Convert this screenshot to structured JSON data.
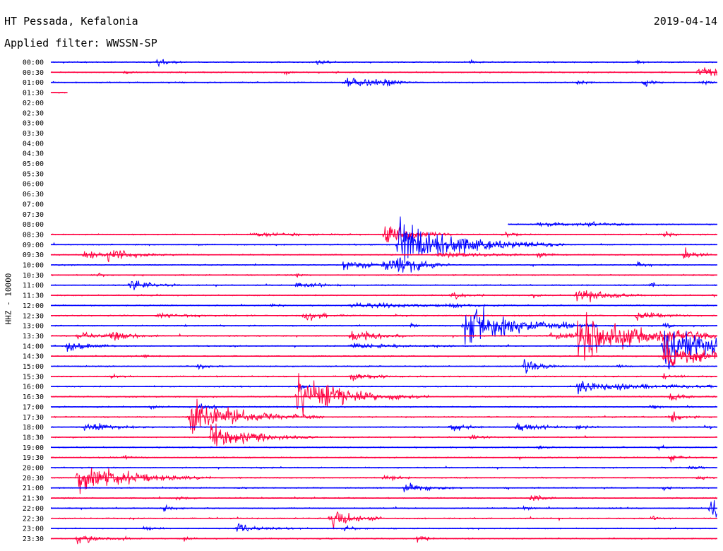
{
  "header": {
    "station": "HT Pessada, Kefalonia",
    "date": "2019-04-14",
    "filter": "Applied filter: WWSSN-SP"
  },
  "chart_data": {
    "type": "line",
    "subtype": "helicorder",
    "title": "HT Pessada, Kefalonia",
    "subtitle": "Applied filter: WWSSN-SP",
    "ylabel": "HHZ - 10000",
    "y_tick_labels": [
      "00:00",
      "00:30",
      "01:00",
      "01:30",
      "02:00",
      "02:30",
      "03:00",
      "03:30",
      "04:00",
      "04:30",
      "05:00",
      "05:30",
      "06:00",
      "06:30",
      "07:00",
      "07:30",
      "08:00",
      "08:30",
      "09:00",
      "09:30",
      "10:00",
      "10:30",
      "11:00",
      "11:30",
      "12:00",
      "12:30",
      "13:00",
      "13:30",
      "14:00",
      "14:30",
      "15:00",
      "15:30",
      "16:00",
      "16:30",
      "17:00",
      "17:30",
      "18:00",
      "18:30",
      "19:00",
      "19:30",
      "20:00",
      "20:30",
      "21:00",
      "21:30",
      "22:00",
      "22:30",
      "23:00",
      "23:30"
    ],
    "trace_colors": [
      "#0000ff",
      "#ff0040"
    ],
    "x_span_minutes": 30,
    "traces": [
      {
        "label": "00:00",
        "start": 0,
        "end": 1,
        "events": [
          [
            0.16,
            12,
            0.4
          ],
          [
            0.4,
            6,
            0.3
          ],
          [
            0.63,
            4,
            0.2
          ],
          [
            0.88,
            5,
            0.2
          ]
        ]
      },
      {
        "label": "00:30",
        "start": 0,
        "end": 1,
        "events": [
          [
            0.11,
            4,
            0.2
          ],
          [
            0.35,
            5,
            0.2
          ],
          [
            0.97,
            10,
            2.5
          ]
        ]
      },
      {
        "label": "01:00",
        "start": 0,
        "end": 1,
        "events": [
          [
            0.44,
            14,
            1.2
          ],
          [
            0.5,
            5,
            0.3
          ],
          [
            0.79,
            5,
            0.3
          ],
          [
            0.89,
            9,
            0.3
          ],
          [
            0.98,
            6,
            0.3
          ]
        ]
      },
      {
        "label": "01:30",
        "start": 0,
        "end": 0.025,
        "events": []
      },
      {
        "label": "02:00",
        "start": 0,
        "end": 0,
        "events": []
      },
      {
        "label": "02:30",
        "start": 0,
        "end": 0,
        "events": []
      },
      {
        "label": "03:00",
        "start": 0,
        "end": 0,
        "events": []
      },
      {
        "label": "03:30",
        "start": 0,
        "end": 0,
        "events": []
      },
      {
        "label": "04:00",
        "start": 0,
        "end": 0,
        "events": []
      },
      {
        "label": "04:30",
        "start": 0,
        "end": 0,
        "events": []
      },
      {
        "label": "05:00",
        "start": 0,
        "end": 0,
        "events": []
      },
      {
        "label": "05:30",
        "start": 0,
        "end": 0,
        "events": []
      },
      {
        "label": "06:00",
        "start": 0,
        "end": 0,
        "events": []
      },
      {
        "label": "06:30",
        "start": 0,
        "end": 0,
        "events": []
      },
      {
        "label": "07:00",
        "start": 0,
        "end": 0,
        "events": []
      },
      {
        "label": "07:30",
        "start": 0,
        "end": 0,
        "events": []
      },
      {
        "label": "08:00",
        "start": 0.686,
        "end": 1,
        "events": [
          [
            0.73,
            4,
            1.5
          ],
          [
            0.8,
            4,
            1.0
          ]
        ]
      },
      {
        "label": "08:30",
        "start": 0,
        "end": 1,
        "events": [
          [
            0.3,
            5,
            1.5
          ],
          [
            0.5,
            30,
            1.0
          ],
          [
            0.68,
            5,
            0.4
          ],
          [
            0.92,
            8,
            0.3
          ]
        ]
      },
      {
        "label": "09:00",
        "start": 0,
        "end": 1,
        "events": [
          [
            0.52,
            48,
            2.5
          ],
          [
            0.62,
            4,
            0.4
          ]
        ]
      },
      {
        "label": "09:30",
        "start": 0,
        "end": 1,
        "events": [
          [
            0.05,
            8,
            1.0
          ],
          [
            0.085,
            9,
            1.2
          ],
          [
            0.58,
            6,
            2.0
          ],
          [
            0.73,
            5,
            0.3
          ],
          [
            0.95,
            12,
            0.5
          ]
        ]
      },
      {
        "label": "10:00",
        "start": 0,
        "end": 1,
        "events": [
          [
            0.44,
            14,
            0.8
          ],
          [
            0.5,
            14,
            0.8
          ],
          [
            0.52,
            25,
            0.8
          ],
          [
            0.88,
            6,
            0.3
          ]
        ]
      },
      {
        "label": "10:30",
        "start": 0,
        "end": 1,
        "events": [
          [
            0.07,
            5,
            0.2
          ],
          [
            0.37,
            4,
            0.2
          ]
        ]
      },
      {
        "label": "11:00",
        "start": 0,
        "end": 1,
        "events": [
          [
            0.12,
            12,
            0.8
          ],
          [
            0.37,
            8,
            0.8
          ],
          [
            0.9,
            5,
            0.3
          ]
        ]
      },
      {
        "label": "11:30",
        "start": 0,
        "end": 1,
        "events": [
          [
            0.6,
            9,
            0.5
          ],
          [
            0.72,
            6,
            0.3
          ],
          [
            0.79,
            20,
            1.0
          ]
        ]
      },
      {
        "label": "12:00",
        "start": 0,
        "end": 1,
        "events": [
          [
            0.33,
            4,
            0.3
          ],
          [
            0.45,
            6,
            2.5
          ],
          [
            0.6,
            4,
            0.5
          ]
        ]
      },
      {
        "label": "12:30",
        "start": 0,
        "end": 1,
        "events": [
          [
            0.16,
            5,
            1.2
          ],
          [
            0.38,
            14,
            0.6
          ],
          [
            0.88,
            10,
            0.8
          ]
        ]
      },
      {
        "label": "13:00",
        "start": 0,
        "end": 1,
        "events": [
          [
            0.62,
            48,
            2.0
          ],
          [
            0.54,
            5,
            0.2
          ],
          [
            0.92,
            6,
            0.3
          ]
        ]
      },
      {
        "label": "13:30",
        "start": 0,
        "end": 1,
        "events": [
          [
            0.04,
            8,
            1.0
          ],
          [
            0.09,
            10,
            0.8
          ],
          [
            0.45,
            14,
            1.0
          ],
          [
            0.75,
            6,
            2.5
          ],
          [
            0.79,
            44,
            2.5
          ],
          [
            0.91,
            8,
            1.5
          ]
        ]
      },
      {
        "label": "14:00",
        "start": 0,
        "end": 1,
        "events": [
          [
            0.025,
            12,
            0.8
          ],
          [
            0.45,
            5,
            2.0
          ],
          [
            0.92,
            46,
            2.5
          ]
        ]
      },
      {
        "label": "14:30",
        "start": 0,
        "end": 1,
        "events": [
          [
            0.14,
            4,
            0.3
          ],
          [
            0.92,
            30,
            1.5
          ]
        ]
      },
      {
        "label": "15:00",
        "start": 0,
        "end": 1,
        "events": [
          [
            0.22,
            6,
            0.4
          ],
          [
            0.71,
            14,
            0.6
          ],
          [
            0.85,
            5,
            0.3
          ]
        ]
      },
      {
        "label": "15:30",
        "start": 0,
        "end": 1,
        "events": [
          [
            0.09,
            4,
            0.3
          ],
          [
            0.45,
            10,
            0.8
          ],
          [
            0.92,
            8,
            0.4
          ]
        ]
      },
      {
        "label": "16:00",
        "start": 0,
        "end": 1,
        "events": [
          [
            0.37,
            8,
            0.3
          ],
          [
            0.79,
            10,
            3.0
          ]
        ]
      },
      {
        "label": "16:30",
        "start": 0,
        "end": 1,
        "events": [
          [
            0.37,
            44,
            2.0
          ],
          [
            0.93,
            10,
            0.5
          ]
        ]
      },
      {
        "label": "17:00",
        "start": 0,
        "end": 1,
        "events": [
          [
            0.15,
            5,
            0.3
          ],
          [
            0.22,
            9,
            0.6
          ],
          [
            0.9,
            5,
            0.3
          ]
        ]
      },
      {
        "label": "17:30",
        "start": 0,
        "end": 1,
        "events": [
          [
            0.21,
            38,
            2.0
          ],
          [
            0.32,
            5,
            0.3
          ],
          [
            0.93,
            10,
            0.5
          ]
        ]
      },
      {
        "label": "18:00",
        "start": 0,
        "end": 1,
        "events": [
          [
            0.05,
            10,
            1.0
          ],
          [
            0.6,
            8,
            0.6
          ],
          [
            0.7,
            12,
            0.8
          ],
          [
            0.79,
            6,
            0.4
          ],
          [
            0.98,
            5,
            0.3
          ]
        ]
      },
      {
        "label": "18:30",
        "start": 0,
        "end": 1,
        "events": [
          [
            0.24,
            25,
            1.6
          ],
          [
            0.31,
            5,
            0.3
          ],
          [
            0.63,
            6,
            0.5
          ]
        ]
      },
      {
        "label": "19:00",
        "start": 0,
        "end": 1,
        "events": [
          [
            0.73,
            5,
            0.3
          ],
          [
            0.91,
            4,
            0.3
          ]
        ]
      },
      {
        "label": "19:30",
        "start": 0,
        "end": 1,
        "events": [
          [
            0.11,
            4,
            0.3
          ],
          [
            0.93,
            8,
            0.3
          ]
        ]
      },
      {
        "label": "20:00",
        "start": 0,
        "end": 1,
        "events": [
          [
            0.96,
            5,
            0.3
          ]
        ]
      },
      {
        "label": "20:30",
        "start": 0,
        "end": 1,
        "events": [
          [
            0.04,
            32,
            2.0
          ],
          [
            0.5,
            8,
            0.5
          ],
          [
            0.97,
            6,
            0.3
          ]
        ]
      },
      {
        "label": "21:00",
        "start": 0,
        "end": 1,
        "events": [
          [
            0.53,
            12,
            0.8
          ],
          [
            0.92,
            5,
            0.3
          ]
        ]
      },
      {
        "label": "21:30",
        "start": 0,
        "end": 1,
        "events": [
          [
            0.19,
            5,
            0.3
          ],
          [
            0.72,
            9,
            0.5
          ]
        ]
      },
      {
        "label": "22:00",
        "start": 0,
        "end": 1,
        "events": [
          [
            0.17,
            6,
            0.4
          ],
          [
            0.71,
            5,
            0.3
          ],
          [
            0.99,
            28,
            1.0
          ]
        ]
      },
      {
        "label": "22:30",
        "start": 0,
        "end": 1,
        "events": [
          [
            0.42,
            22,
            0.8
          ],
          [
            0.9,
            5,
            0.3
          ]
        ]
      },
      {
        "label": "23:00",
        "start": 0,
        "end": 1,
        "events": [
          [
            0.14,
            5,
            0.3
          ],
          [
            0.28,
            8,
            1.0
          ],
          [
            0.44,
            5,
            0.4
          ]
        ]
      },
      {
        "label": "23:30",
        "start": 0,
        "end": 1,
        "events": [
          [
            0.04,
            10,
            0.8
          ],
          [
            0.2,
            5,
            0.3
          ],
          [
            0.55,
            6,
            0.4
          ]
        ]
      }
    ]
  }
}
